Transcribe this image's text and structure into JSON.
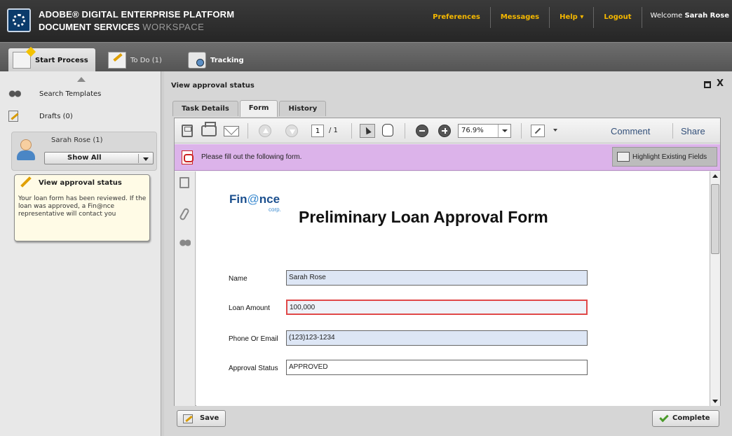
{
  "header": {
    "brand_line1": "ADOBE® DIGITAL ENTERPRISE PLATFORM",
    "brand_line2_bold": "DOCUMENT SERVICES",
    "brand_line2_light": "WORKSPACE",
    "links": [
      "Preferences",
      "Messages",
      "Help ▾",
      "Logout"
    ],
    "welcome_prefix": "Welcome",
    "welcome_user": "Sarah Rose"
  },
  "tabs": {
    "start": "Start Process",
    "todo": "To Do (1)",
    "tracking": "Tracking"
  },
  "sidebar": {
    "search_templates": "Search Templates",
    "drafts": "Drafts (0)",
    "user_name": "Sarah Rose (1)",
    "filter": "Show All",
    "task_title": "View approval status",
    "task_description": "Your loan form has been reviewed. If the loan was approved, a Fin@nce representative will contact you"
  },
  "main": {
    "title": "View approval status",
    "close": "X",
    "subtabs": [
      "Task Details",
      "Form",
      "History"
    ],
    "active_subtab": "Form"
  },
  "toolbar": {
    "page_current": "1",
    "page_total": "/ 1",
    "zoom": "76.9%",
    "comment": "Comment",
    "share": "Share"
  },
  "message": {
    "text": "Please fill out the following form.",
    "highlight_button": "Highlight Existing Fields",
    "color": "#dcb3ea"
  },
  "document": {
    "logo_text_1": "Fin",
    "logo_text_at": "@",
    "logo_text_2": "nce",
    "logo_corp": "corp.",
    "title": "Preliminary Loan Approval Form",
    "fields": [
      {
        "label": "Name",
        "value": "Sarah Rose"
      },
      {
        "label": "Loan Amount",
        "value": "100,000"
      },
      {
        "label": "Phone Or Email",
        "value": "(123)123-1234"
      },
      {
        "label": "Approval Status",
        "value": "APPROVED"
      }
    ]
  },
  "footer": {
    "save": "Save",
    "complete": "Complete"
  },
  "colors": {
    "header_link": "#f5b800",
    "error_border": "#e04848",
    "field_bg": "#dde6f5"
  }
}
